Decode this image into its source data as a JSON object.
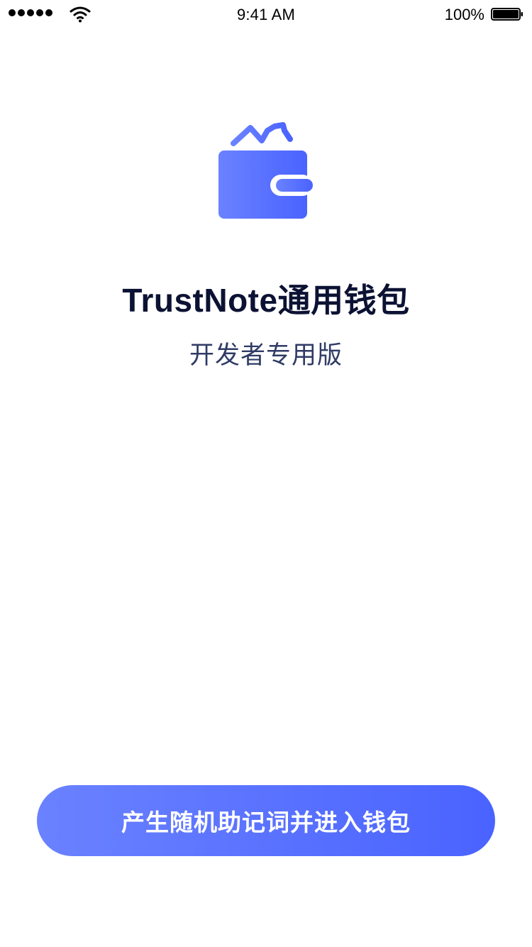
{
  "status_bar": {
    "time": "9:41 AM",
    "battery_percent": "100%",
    "signal_icon": "signal-dots-icon",
    "wifi_icon": "wifi-icon",
    "battery_icon": "battery-icon"
  },
  "hero": {
    "logo_icon": "wallet-icon",
    "title": "TrustNote通用钱包",
    "subtitle": "开发者专用版"
  },
  "actions": {
    "primary_label": "产生随机助记词并进入钱包"
  },
  "colors": {
    "accent_start": "#6a82ff",
    "accent_end": "#4a63ff",
    "title": "#0c1233",
    "subtitle": "#2f3b66"
  }
}
